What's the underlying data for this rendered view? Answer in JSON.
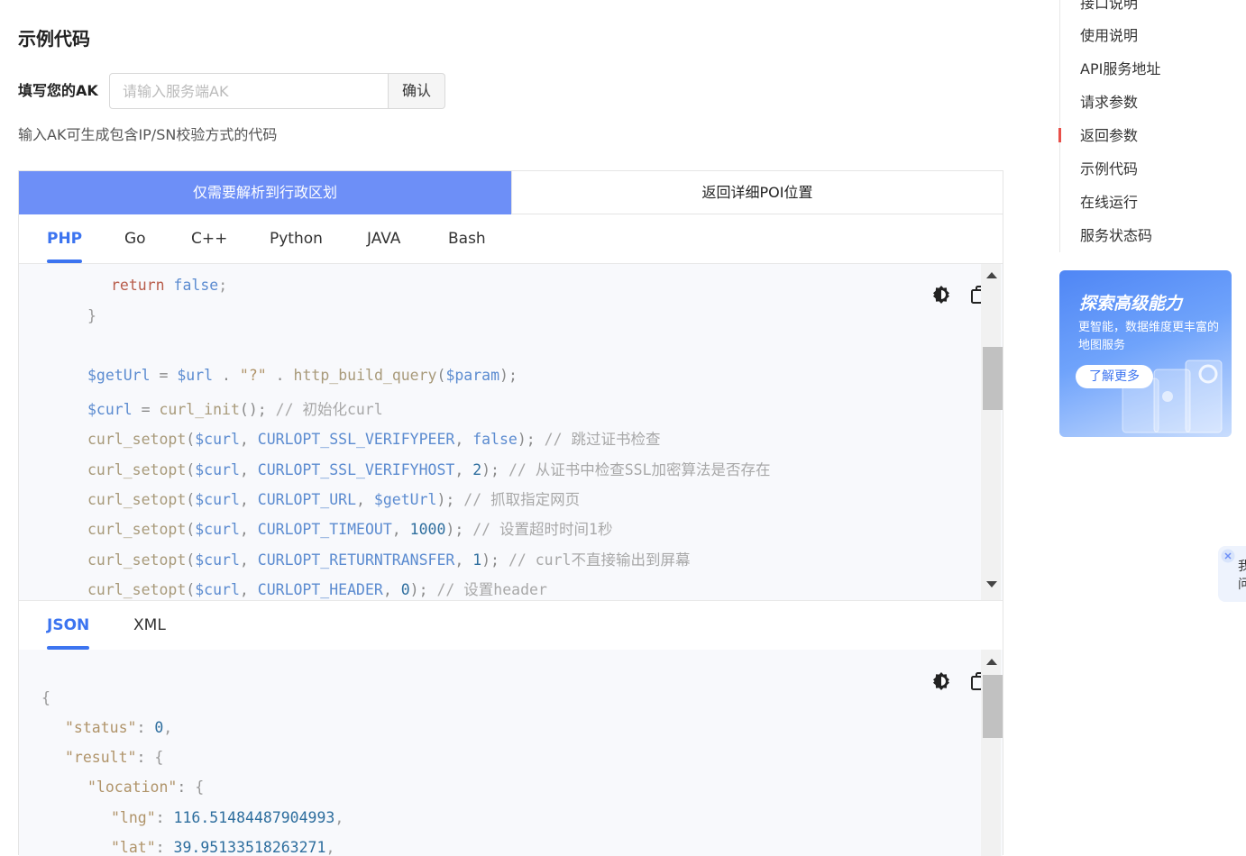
{
  "section_title": "示例代码",
  "ak": {
    "label": "填写您的AK",
    "placeholder": "请输入服务端AK",
    "value": "",
    "confirm": "确认",
    "hint": "输入AK可生成包含IP/SN校验方式的代码"
  },
  "segments": [
    "仅需要解析到行政区划",
    "返回详细POI位置"
  ],
  "lang_tabs": [
    "PHP",
    "Go",
    "C++",
    "Python",
    "JAVA",
    "Bash"
  ],
  "format_tabs": [
    "JSON",
    "XML"
  ],
  "toc": [
    "接口说明",
    "使用说明",
    "API服务地址",
    "请求参数",
    "返回参数",
    "示例代码",
    "在线运行",
    "服务状态码"
  ],
  "toc_active": "返回参数",
  "promo": {
    "title": "探索高级能力",
    "subtitle": "更智能，数据维度更丰富的地图服务",
    "button": "了解更多"
  },
  "float_text": [
    "我",
    "问"
  ],
  "icons": {
    "theme": "theme-toggle-icon",
    "copy": "copy-icon",
    "close": "close-icon"
  },
  "colors": {
    "accent": "#3c74f0",
    "segment_active": "#6d8ff7",
    "toc_marker": "#e8504a"
  }
}
